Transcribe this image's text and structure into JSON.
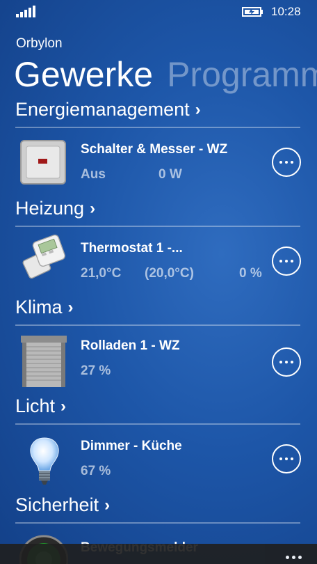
{
  "status": {
    "time": "10:28",
    "signal_icon": "signal-bars-icon",
    "battery_icon": "battery-charging-icon"
  },
  "app": {
    "title": "Orbylon"
  },
  "pivot": {
    "active": "Gewerke",
    "next": "Programm"
  },
  "sections": [
    {
      "label": "Energiemanagement",
      "chevron": "›"
    },
    {
      "label": "Heizung",
      "chevron": "›"
    },
    {
      "label": "Klima",
      "chevron": "›"
    },
    {
      "label": "Licht",
      "chevron": "›"
    },
    {
      "label": "Sicherheit",
      "chevron": "›"
    }
  ],
  "devices": [
    {
      "name": "Schalter & Messer - WZ",
      "values": [
        "Aus",
        "0 W"
      ],
      "icon": "switch-icon"
    },
    {
      "name": "Thermostat 1 -...",
      "values": [
        "21,0°C",
        "(20,0°C)",
        "0 %"
      ],
      "icon": "thermostat-icon"
    },
    {
      "name": "Rolladen 1 - WZ",
      "values": [
        "27 %"
      ],
      "icon": "shutter-icon"
    },
    {
      "name": "Dimmer - Küche",
      "values": [
        "67 %"
      ],
      "icon": "light-bulb-icon"
    },
    {
      "name": "Bewegungsmelder",
      "values": [],
      "icon": "motion-sensor-icon"
    }
  ],
  "colors": {
    "background": "#1d56a8",
    "accent": "#ffffff",
    "secondary_text": "#a8c0e2"
  }
}
